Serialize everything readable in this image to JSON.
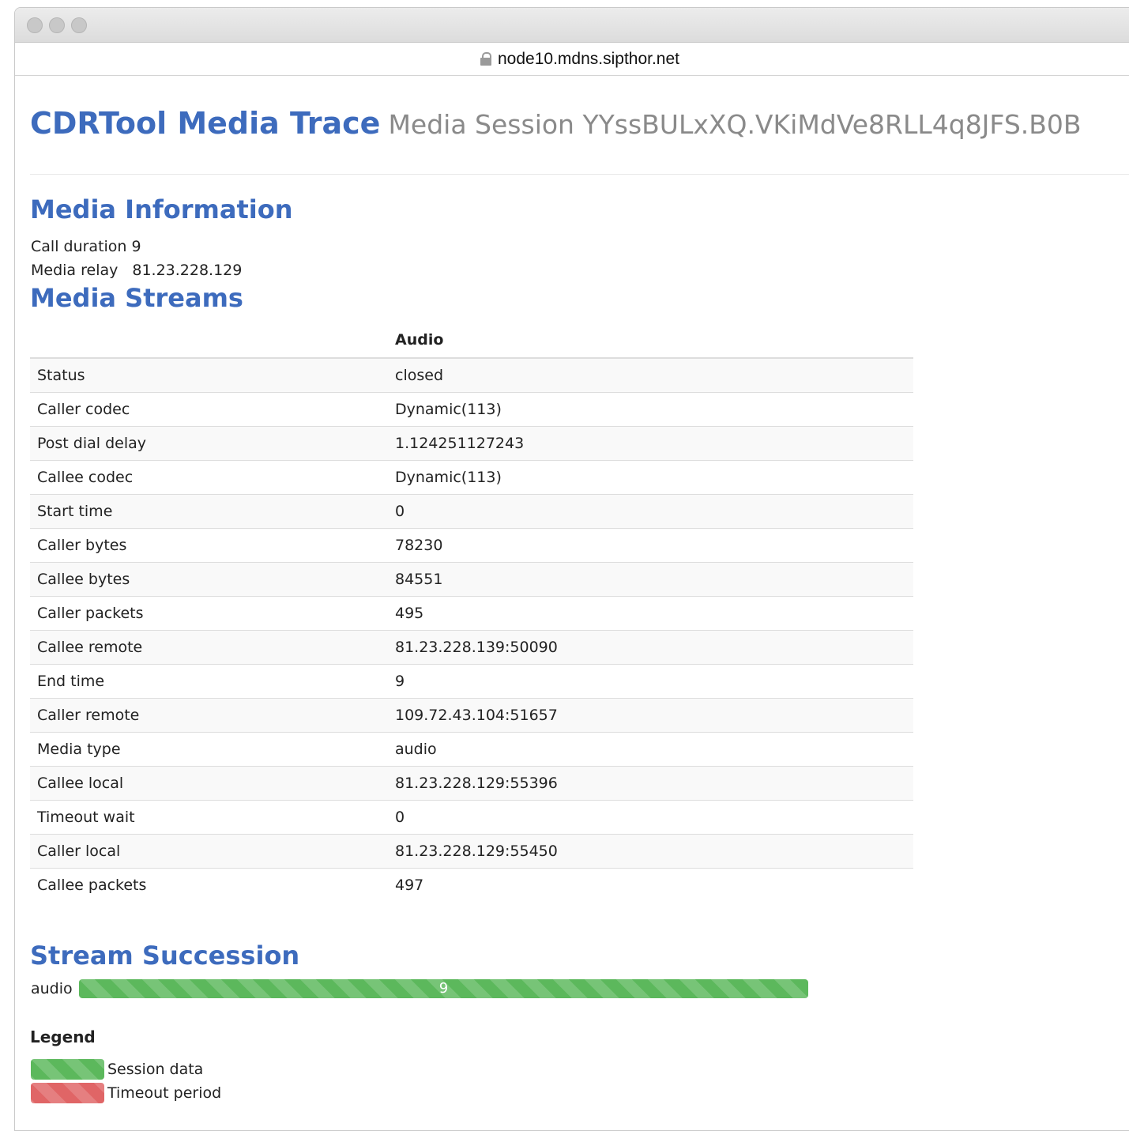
{
  "browser": {
    "url": "node10.mdns.sipthor.net"
  },
  "header": {
    "title": "CDRTool Media Trace",
    "subtitle": "Media Session YYssBULxXQ.VKiMdVe8RLL4q8JFS.B0B"
  },
  "media_information": {
    "heading": "Media Information",
    "call_duration_label": "Call duration",
    "call_duration_value": "9",
    "media_relay_label": "Media relay",
    "media_relay_value": "81.23.228.129"
  },
  "media_streams": {
    "heading": "Media Streams",
    "column_header": "Audio",
    "rows": [
      {
        "label": "Status",
        "value": "closed"
      },
      {
        "label": "Caller codec",
        "value": "Dynamic(113)"
      },
      {
        "label": "Post dial delay",
        "value": "1.124251127243"
      },
      {
        "label": "Callee codec",
        "value": "Dynamic(113)"
      },
      {
        "label": "Start time",
        "value": "0"
      },
      {
        "label": "Caller bytes",
        "value": "78230"
      },
      {
        "label": "Callee bytes",
        "value": "84551"
      },
      {
        "label": "Caller packets",
        "value": "495"
      },
      {
        "label": "Callee remote",
        "value": "81.23.228.139:50090"
      },
      {
        "label": "End time",
        "value": "9"
      },
      {
        "label": "Caller remote",
        "value": "109.72.43.104:51657"
      },
      {
        "label": "Media type",
        "value": "audio"
      },
      {
        "label": "Callee local",
        "value": "81.23.228.129:55396"
      },
      {
        "label": "Timeout wait",
        "value": "0"
      },
      {
        "label": "Caller local",
        "value": "81.23.228.129:55450"
      },
      {
        "label": "Callee packets",
        "value": "497"
      }
    ]
  },
  "stream_succession": {
    "heading": "Stream Succession",
    "stream_label": "audio",
    "bar_value": "9",
    "bar_session_fraction": 1.0,
    "bar_color": "#5cb85c"
  },
  "legend": {
    "title": "Legend",
    "items": [
      {
        "label": "Session data",
        "color": "#5cb85c"
      },
      {
        "label": "Timeout period",
        "color": "#e06566"
      }
    ]
  }
}
